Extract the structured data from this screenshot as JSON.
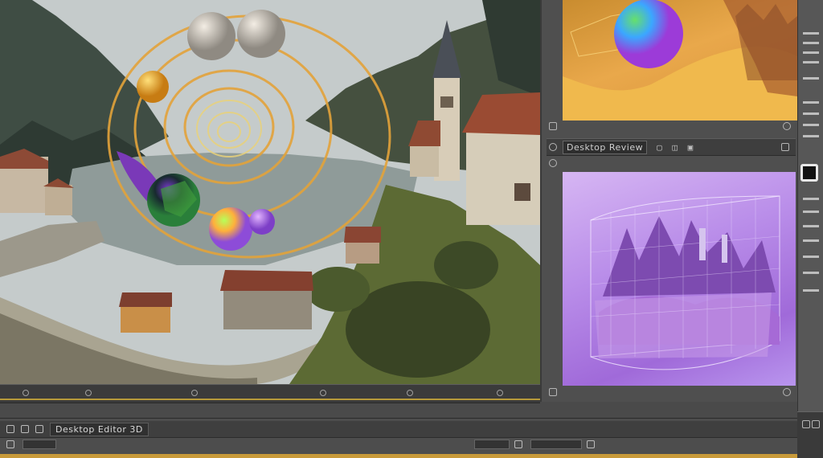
{
  "app": {
    "main_viewport": {
      "name": "3D Scene Viewport",
      "annotations": [
        "Orbiting spheres",
        "Mountain lake village"
      ]
    },
    "panel_header": {
      "title": "Desktop Review",
      "tools": "▢ ◫ ▣"
    },
    "panel_a": {
      "name": "Sphere preview"
    },
    "panel_b": {
      "name": "Wireframe landscape preview"
    },
    "bottom_toolbar": {
      "label": "Desktop Editor 3D"
    },
    "icons": {
      "play": "play-icon",
      "settings": "gear-icon",
      "close": "close-icon"
    },
    "colors": {
      "accent_orange": "#e3a33a",
      "accent_purple": "#b48ae6",
      "ui_dark": "#3b3b3b"
    }
  }
}
